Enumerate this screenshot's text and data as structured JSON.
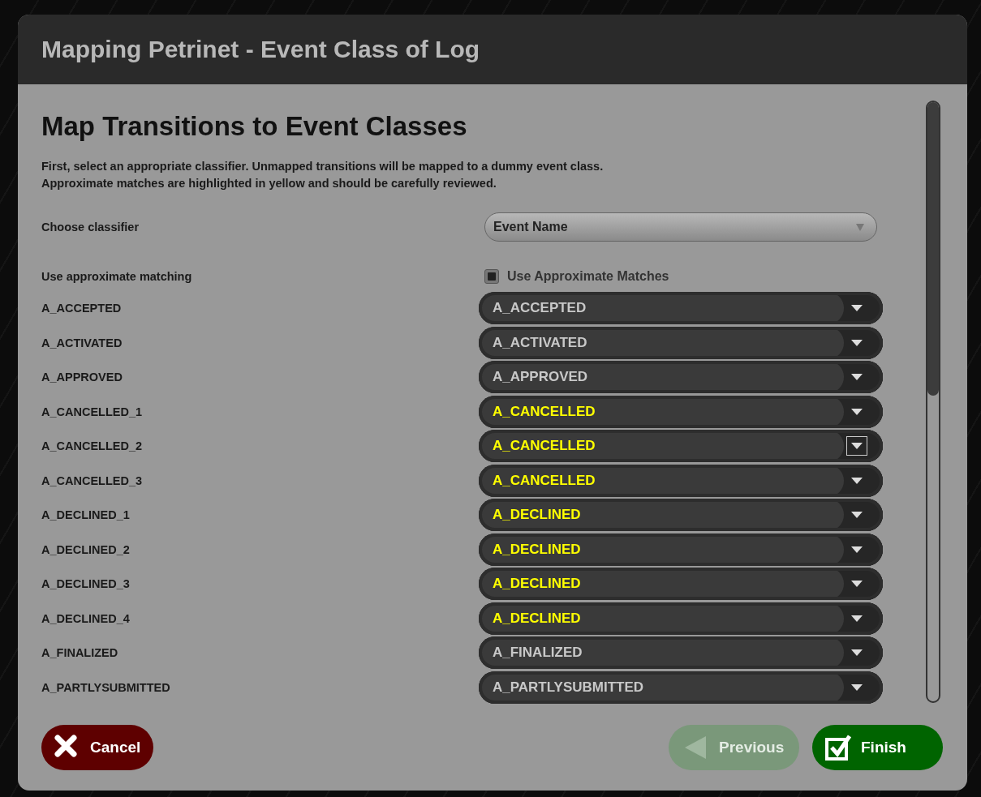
{
  "window": {
    "title": "Mapping Petrinet - Event Class of Log"
  },
  "heading": "Map Transitions to Event Classes",
  "description": [
    "First, select an appropriate classifier. Unmapped transitions will be mapped to a dummy event class.",
    "Approximate matches are highlighted in yellow and should be carefully reviewed."
  ],
  "classifier": {
    "label": "Choose classifier",
    "value": "Event Name"
  },
  "approximate": {
    "label": "Use approximate matching",
    "option": "Use Approximate Matches",
    "checked": false
  },
  "mappings": [
    {
      "transition": "A_ACCEPTED",
      "event_class": "A_ACCEPTED",
      "approximate": false,
      "focused": false
    },
    {
      "transition": "A_ACTIVATED",
      "event_class": "A_ACTIVATED",
      "approximate": false,
      "focused": false
    },
    {
      "transition": "A_APPROVED",
      "event_class": "A_APPROVED",
      "approximate": false,
      "focused": false
    },
    {
      "transition": "A_CANCELLED_1",
      "event_class": "A_CANCELLED",
      "approximate": true,
      "focused": false
    },
    {
      "transition": "A_CANCELLED_2",
      "event_class": "A_CANCELLED",
      "approximate": true,
      "focused": true
    },
    {
      "transition": "A_CANCELLED_3",
      "event_class": "A_CANCELLED",
      "approximate": true,
      "focused": false
    },
    {
      "transition": "A_DECLINED_1",
      "event_class": "A_DECLINED",
      "approximate": true,
      "focused": false
    },
    {
      "transition": "A_DECLINED_2",
      "event_class": "A_DECLINED",
      "approximate": true,
      "focused": false
    },
    {
      "transition": "A_DECLINED_3",
      "event_class": "A_DECLINED",
      "approximate": true,
      "focused": false
    },
    {
      "transition": "A_DECLINED_4",
      "event_class": "A_DECLINED",
      "approximate": true,
      "focused": false
    },
    {
      "transition": "A_FINALIZED",
      "event_class": "A_FINALIZED",
      "approximate": false,
      "focused": false
    },
    {
      "transition": "A_PARTLYSUBMITTED",
      "event_class": "A_PARTLYSUBMITTED",
      "approximate": false,
      "focused": false
    }
  ],
  "buttons": [
    {
      "label": "Cancel",
      "kind": "cancel",
      "disabled": false
    },
    {
      "label": "Previous",
      "kind": "previous",
      "disabled": true
    },
    {
      "label": "Finish",
      "kind": "finish",
      "disabled": false
    }
  ]
}
